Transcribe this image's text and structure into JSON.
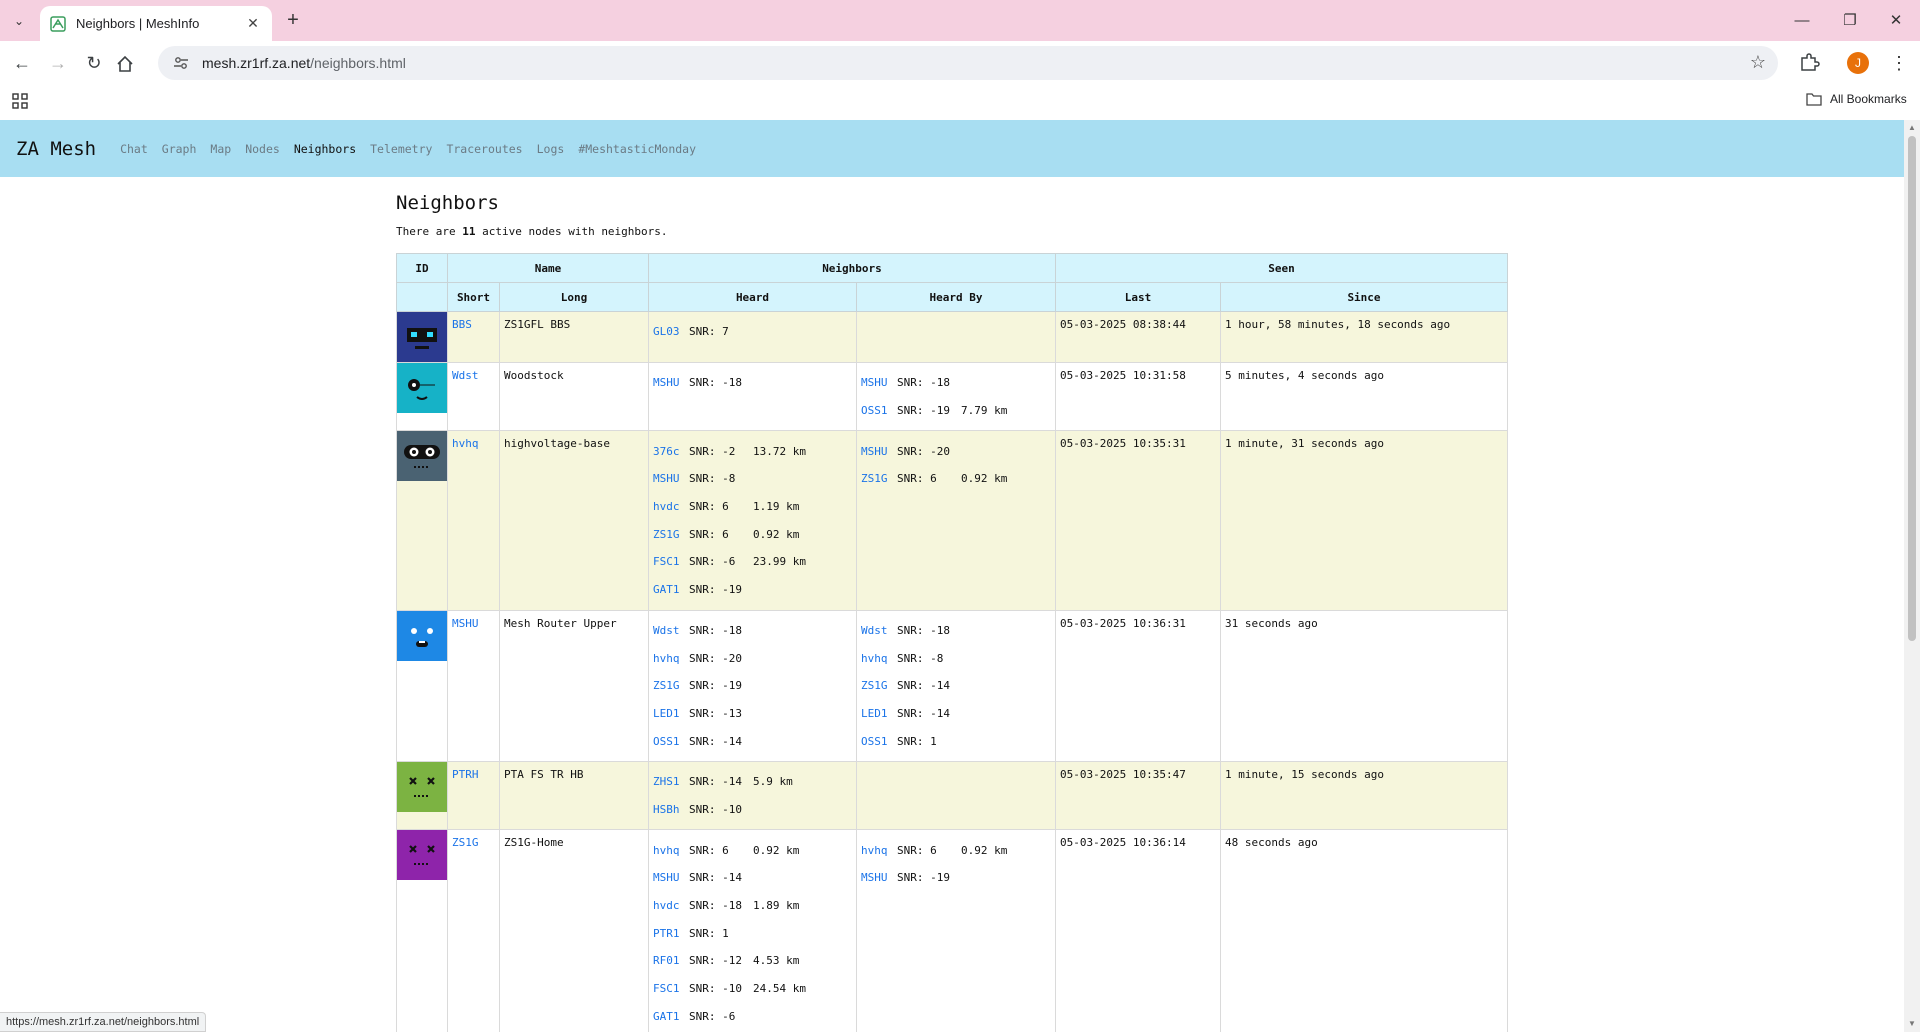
{
  "browser": {
    "tab_title": "Neighbors | MeshInfo",
    "url_host": "mesh.zr1rf.za.net",
    "url_path": "/neighbors.html",
    "profile_initial": "J",
    "all_bookmarks": "All Bookmarks",
    "status_url": "https://mesh.zr1rf.za.net/neighbors.html"
  },
  "site": {
    "brand": "ZA Mesh",
    "nav": [
      "Chat",
      "Graph",
      "Map",
      "Nodes",
      "Neighbors",
      "Telemetry",
      "Traceroutes",
      "Logs",
      "#MeshtasticMonday"
    ],
    "active_nav": "Neighbors"
  },
  "page": {
    "title": "Neighbors",
    "summary_pre": "There are ",
    "summary_count": "11",
    "summary_post": " active nodes with neighbors."
  },
  "table": {
    "group_headers": {
      "id": "ID",
      "name": "Name",
      "neighbors": "Neighbors",
      "seen": "Seen"
    },
    "sub_headers": {
      "short": "Short",
      "long": "Long",
      "heard": "Heard",
      "heard_by": "Heard By",
      "last": "Last",
      "since": "Since"
    },
    "rows": [
      {
        "avatar": "robot-avatar-navy",
        "short": "BBS",
        "long": "ZS1GFL BBS",
        "heard": [
          {
            "node": "GL03",
            "snr": "SNR: 7",
            "dist": ""
          }
        ],
        "heard_by": [],
        "last": "05-03-2025 08:38:44",
        "since": "1 hour, 58 minutes, 18 seconds ago"
      },
      {
        "avatar": "robot-avatar-teal",
        "short": "Wdst",
        "long": "Woodstock",
        "heard": [
          {
            "node": "MSHU",
            "snr": "SNR: -18",
            "dist": ""
          }
        ],
        "heard_by": [
          {
            "node": "MSHU",
            "snr": "SNR: -18",
            "dist": ""
          },
          {
            "node": "OSS1",
            "snr": "SNR: -19",
            "dist": "7.79 km"
          }
        ],
        "last": "05-03-2025 10:31:58",
        "since": "5 minutes, 4 seconds ago"
      },
      {
        "avatar": "robot-avatar-slate",
        "short": "hvhq",
        "long": "highvoltage-base",
        "heard": [
          {
            "node": "376c",
            "snr": "SNR: -2",
            "dist": "13.72 km"
          },
          {
            "node": "MSHU",
            "snr": "SNR: -8",
            "dist": ""
          },
          {
            "node": "hvdc",
            "snr": "SNR: 6",
            "dist": "1.19 km"
          },
          {
            "node": "ZS1G",
            "snr": "SNR: 6",
            "dist": "0.92 km"
          },
          {
            "node": "FSC1",
            "snr": "SNR: -6",
            "dist": "23.99 km"
          },
          {
            "node": "GAT1",
            "snr": "SNR: -19",
            "dist": ""
          }
        ],
        "heard_by": [
          {
            "node": "MSHU",
            "snr": "SNR: -20",
            "dist": ""
          },
          {
            "node": "ZS1G",
            "snr": "SNR: 6",
            "dist": "0.92 km"
          }
        ],
        "last": "05-03-2025 10:35:31",
        "since": "1 minute, 31 seconds ago"
      },
      {
        "avatar": "robot-avatar-blue",
        "short": "MSHU",
        "long": "Mesh Router Upper",
        "heard": [
          {
            "node": "Wdst",
            "snr": "SNR: -18",
            "dist": ""
          },
          {
            "node": "hvhq",
            "snr": "SNR: -20",
            "dist": ""
          },
          {
            "node": "ZS1G",
            "snr": "SNR: -19",
            "dist": ""
          },
          {
            "node": "LED1",
            "snr": "SNR: -13",
            "dist": ""
          },
          {
            "node": "OSS1",
            "snr": "SNR: -14",
            "dist": ""
          }
        ],
        "heard_by": [
          {
            "node": "Wdst",
            "snr": "SNR: -18",
            "dist": ""
          },
          {
            "node": "hvhq",
            "snr": "SNR: -8",
            "dist": ""
          },
          {
            "node": "ZS1G",
            "snr": "SNR: -14",
            "dist": ""
          },
          {
            "node": "LED1",
            "snr": "SNR: -14",
            "dist": ""
          },
          {
            "node": "OSS1",
            "snr": "SNR: 1",
            "dist": ""
          }
        ],
        "last": "05-03-2025 10:36:31",
        "since": "31 seconds ago"
      },
      {
        "avatar": "robot-avatar-green",
        "short": "PTRH",
        "long": "PTA FS TR HB",
        "heard": [
          {
            "node": "ZHS1",
            "snr": "SNR: -14",
            "dist": "5.9 km"
          },
          {
            "node": "HSBh",
            "snr": "SNR: -10",
            "dist": ""
          }
        ],
        "heard_by": [],
        "last": "05-03-2025 10:35:47",
        "since": "1 minute, 15 seconds ago"
      },
      {
        "avatar": "robot-avatar-purple",
        "short": "ZS1G",
        "long": "ZS1G-Home",
        "heard": [
          {
            "node": "hvhq",
            "snr": "SNR: 6",
            "dist": "0.92 km"
          },
          {
            "node": "MSHU",
            "snr": "SNR: -14",
            "dist": ""
          },
          {
            "node": "hvdc",
            "snr": "SNR: -18",
            "dist": "1.89 km"
          },
          {
            "node": "PTR1",
            "snr": "SNR: 1",
            "dist": ""
          },
          {
            "node": "RF01",
            "snr": "SNR: -12",
            "dist": "4.53 km"
          },
          {
            "node": "FSC1",
            "snr": "SNR: -10",
            "dist": "24.54 km"
          },
          {
            "node": "GAT1",
            "snr": "SNR: -6",
            "dist": ""
          }
        ],
        "heard_by": [
          {
            "node": "hvhq",
            "snr": "SNR: 6",
            "dist": "0.92 km"
          },
          {
            "node": "MSHU",
            "snr": "SNR: -19",
            "dist": ""
          }
        ],
        "last": "05-03-2025 10:36:14",
        "since": "48 seconds ago"
      }
    ]
  },
  "colors": {
    "nav_bg": "#a8def2",
    "header_bg": "#d4f4fd",
    "odd_row_bg": "#f6f6dc",
    "link": "#1a73e8",
    "tabstrip": "#f5d0e0"
  }
}
